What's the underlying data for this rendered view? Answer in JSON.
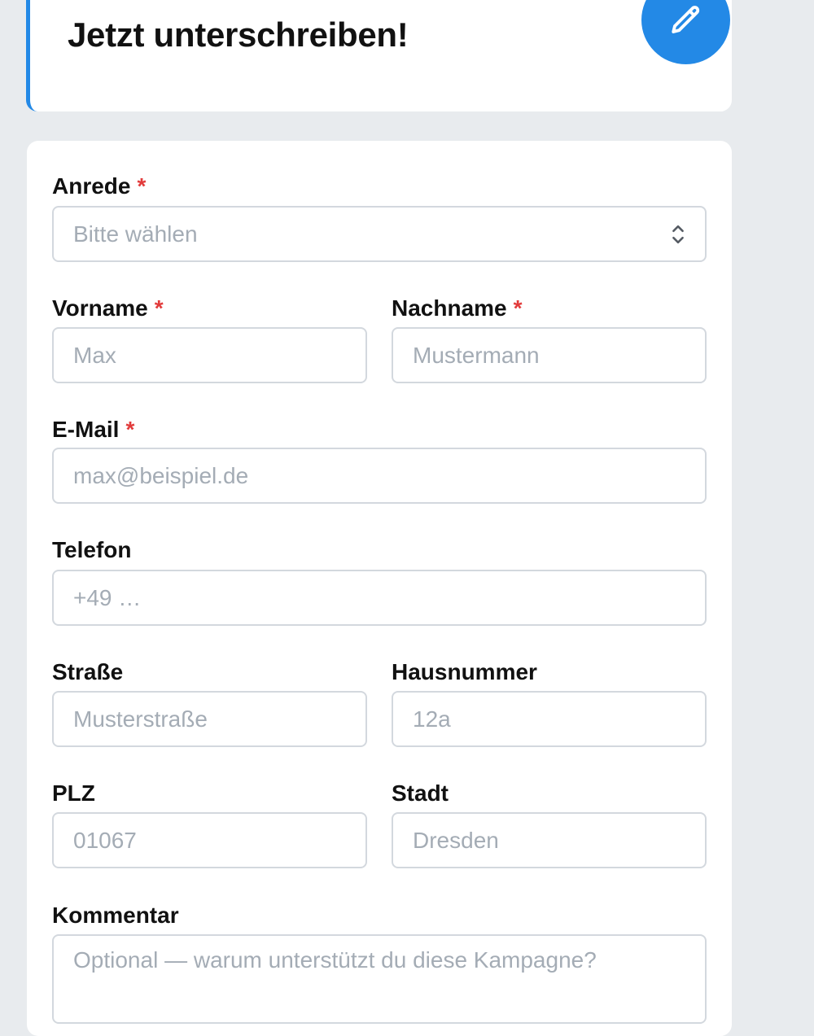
{
  "header": {
    "title": "Jetzt unterschreiben!",
    "accent_color": "#2389e6",
    "action_icon": "pencil-icon"
  },
  "form": {
    "required_marker": "*",
    "fields": {
      "anrede": {
        "label": "Anrede",
        "placeholder": "Bitte wählen",
        "required": true,
        "type": "select"
      },
      "vorname": {
        "label": "Vorname",
        "placeholder": "Max",
        "required": true
      },
      "nachname": {
        "label": "Nachname",
        "placeholder": "Mustermann",
        "required": true
      },
      "email": {
        "label": "E-Mail",
        "placeholder": "max@beispiel.de",
        "required": true
      },
      "telefon": {
        "label": "Telefon",
        "placeholder": "+49 …",
        "required": false
      },
      "strasse": {
        "label": "Straße",
        "placeholder": "Musterstraße",
        "required": false
      },
      "hausnummer": {
        "label": "Hausnummer",
        "placeholder": "12a",
        "required": false
      },
      "plz": {
        "label": "PLZ",
        "placeholder": "01067",
        "required": false
      },
      "stadt": {
        "label": "Stadt",
        "placeholder": "Dresden",
        "required": false
      },
      "kommentar": {
        "label": "Kommentar",
        "placeholder": "Optional — warum unterstützt du diese Kampagne?",
        "required": false
      }
    }
  }
}
